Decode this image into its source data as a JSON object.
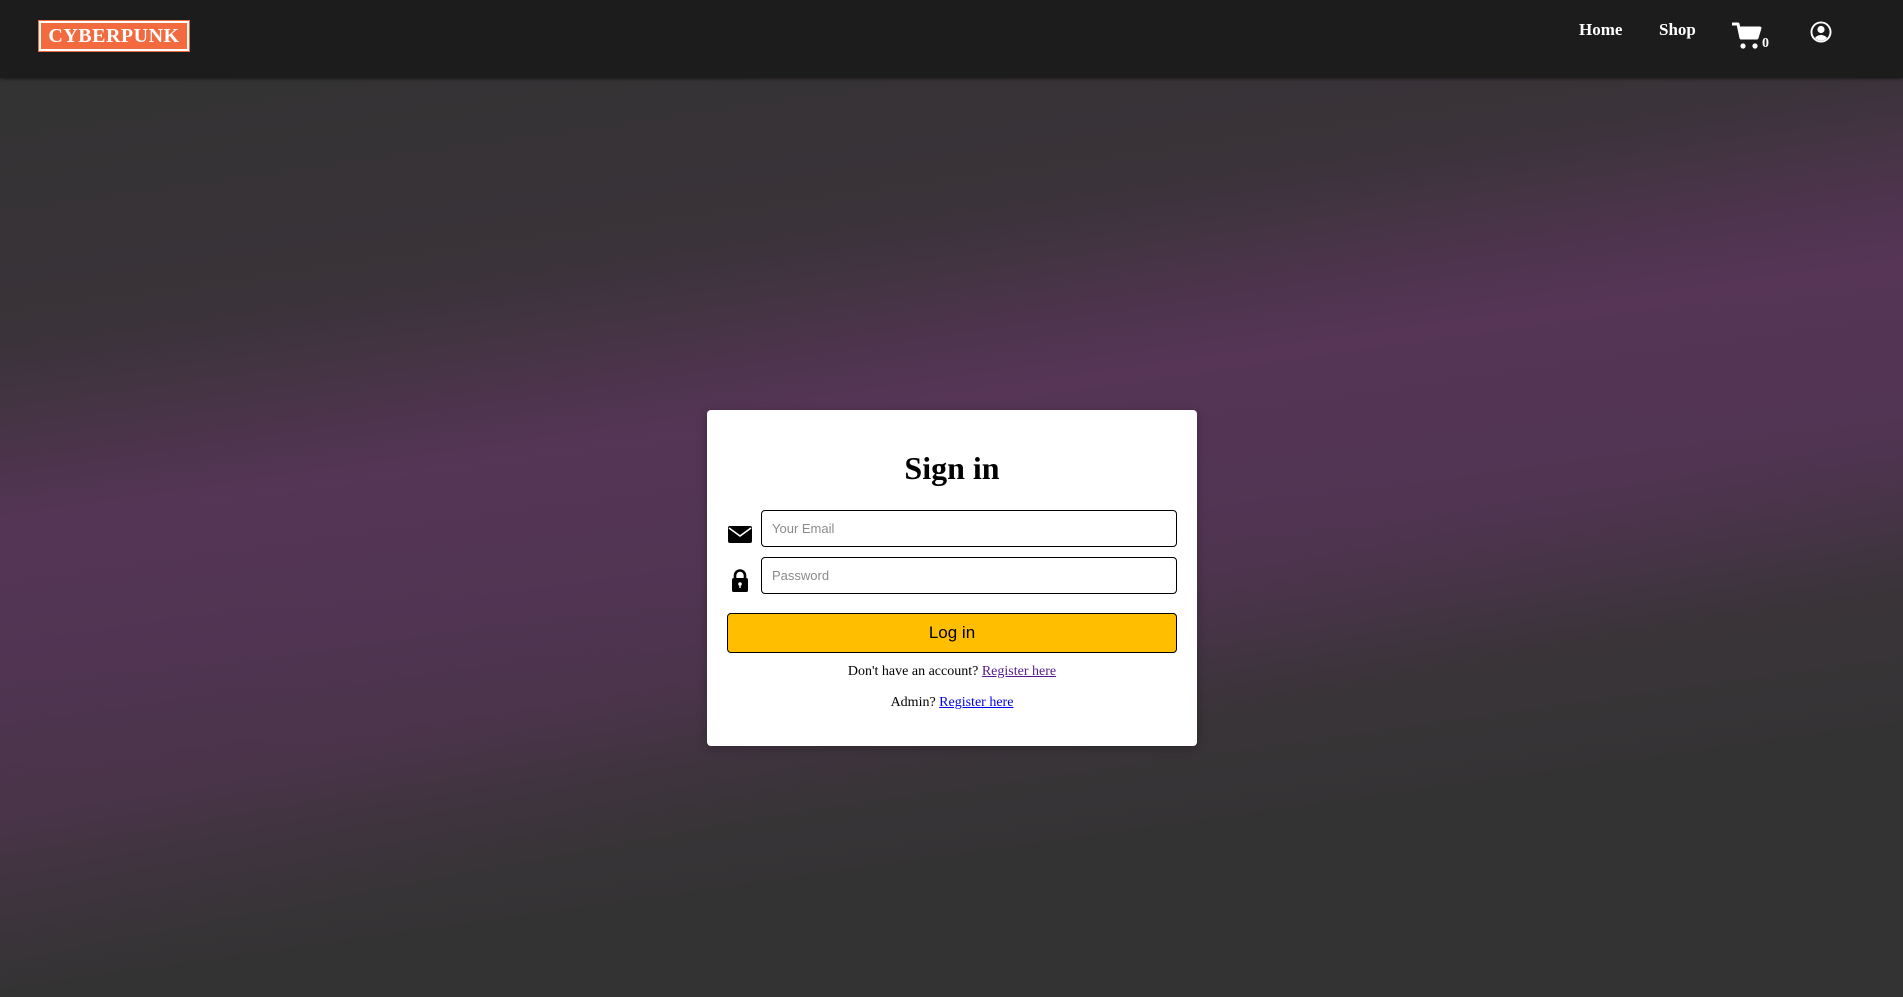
{
  "navbar": {
    "logo_text": "CYBERPUNK",
    "links": [
      {
        "label": "Home"
      },
      {
        "label": "Shop"
      }
    ],
    "cart": {
      "icon": "cart-icon",
      "count": "0"
    },
    "account": {
      "icon": "user-circle-icon"
    }
  },
  "signin": {
    "title": "Sign in",
    "email": {
      "icon": "envelope-icon",
      "placeholder": "Your Email",
      "value": ""
    },
    "password": {
      "icon": "lock-icon",
      "placeholder": "Password",
      "value": ""
    },
    "login_label": "Log in",
    "register_prompt": "Don't have an account?",
    "register_link": "Register here",
    "admin_prompt": "Admin?",
    "admin_link": "Register here"
  },
  "colors": {
    "navbar_bg": "#1c1c1c",
    "logo_bg": "#f26a3d",
    "button_bg": "#ffbf00",
    "page_bg": "#333333",
    "accent_purple": "#553555"
  }
}
